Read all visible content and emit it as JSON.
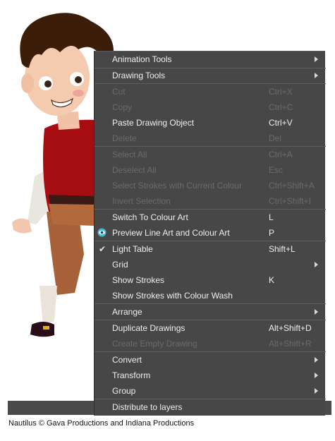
{
  "menu": {
    "items": [
      {
        "label": "Animation Tools",
        "shortcut": "",
        "submenu": true,
        "enabled": true
      },
      {
        "label": "Drawing Tools",
        "shortcut": "",
        "submenu": true,
        "enabled": true
      },
      {
        "label": "Cut",
        "shortcut": "Ctrl+X",
        "enabled": false
      },
      {
        "label": "Copy",
        "shortcut": "Ctrl+C",
        "enabled": false
      },
      {
        "label": "Paste Drawing Object",
        "shortcut": "Ctrl+V",
        "enabled": true
      },
      {
        "label": "Delete",
        "shortcut": "Del",
        "enabled": false
      },
      {
        "label": "Select All",
        "shortcut": "Ctrl+A",
        "enabled": false
      },
      {
        "label": "Deselect All",
        "shortcut": "Esc",
        "enabled": false
      },
      {
        "label": "Select Strokes with Current Colour",
        "shortcut": "Ctrl+Shift+A",
        "enabled": false
      },
      {
        "label": "Invert Selection",
        "shortcut": "Ctrl+Shift+I",
        "enabled": false
      },
      {
        "label": "Switch To Colour Art",
        "shortcut": "L",
        "enabled": true
      },
      {
        "label": "Preview Line Art and Colour Art",
        "shortcut": "P",
        "enabled": true,
        "icon": "eye-icon"
      },
      {
        "label": "Light Table",
        "shortcut": "Shift+L",
        "enabled": true,
        "checked": true
      },
      {
        "label": "Grid",
        "shortcut": "",
        "submenu": true,
        "enabled": true
      },
      {
        "label": "Show Strokes",
        "shortcut": "K",
        "enabled": true
      },
      {
        "label": "Show Strokes with Colour Wash",
        "shortcut": "",
        "enabled": true
      },
      {
        "label": "Arrange",
        "shortcut": "",
        "submenu": true,
        "enabled": true
      },
      {
        "label": "Duplicate Drawings",
        "shortcut": "Alt+Shift+D",
        "enabled": true
      },
      {
        "label": "Create Empty Drawing",
        "shortcut": "Alt+Shift+R",
        "enabled": false
      },
      {
        "label": "Convert",
        "shortcut": "",
        "submenu": true,
        "enabled": true
      },
      {
        "label": "Transform",
        "shortcut": "",
        "submenu": true,
        "enabled": true
      },
      {
        "label": "Group",
        "shortcut": "",
        "submenu": true,
        "enabled": true
      },
      {
        "label": "Distribute to layers",
        "shortcut": "",
        "enabled": true
      }
    ]
  },
  "caption": "Nautilus © Gava Productions and Indiana Productions",
  "colors": {
    "menu_bg": "#474747",
    "text": "#eeeeee",
    "disabled_text": "#6b6b6b",
    "separator": "#5d5d5d",
    "shirt": "#a50d12",
    "hair": "#3b1d0a",
    "eye_icon": "#3fb8d8"
  }
}
